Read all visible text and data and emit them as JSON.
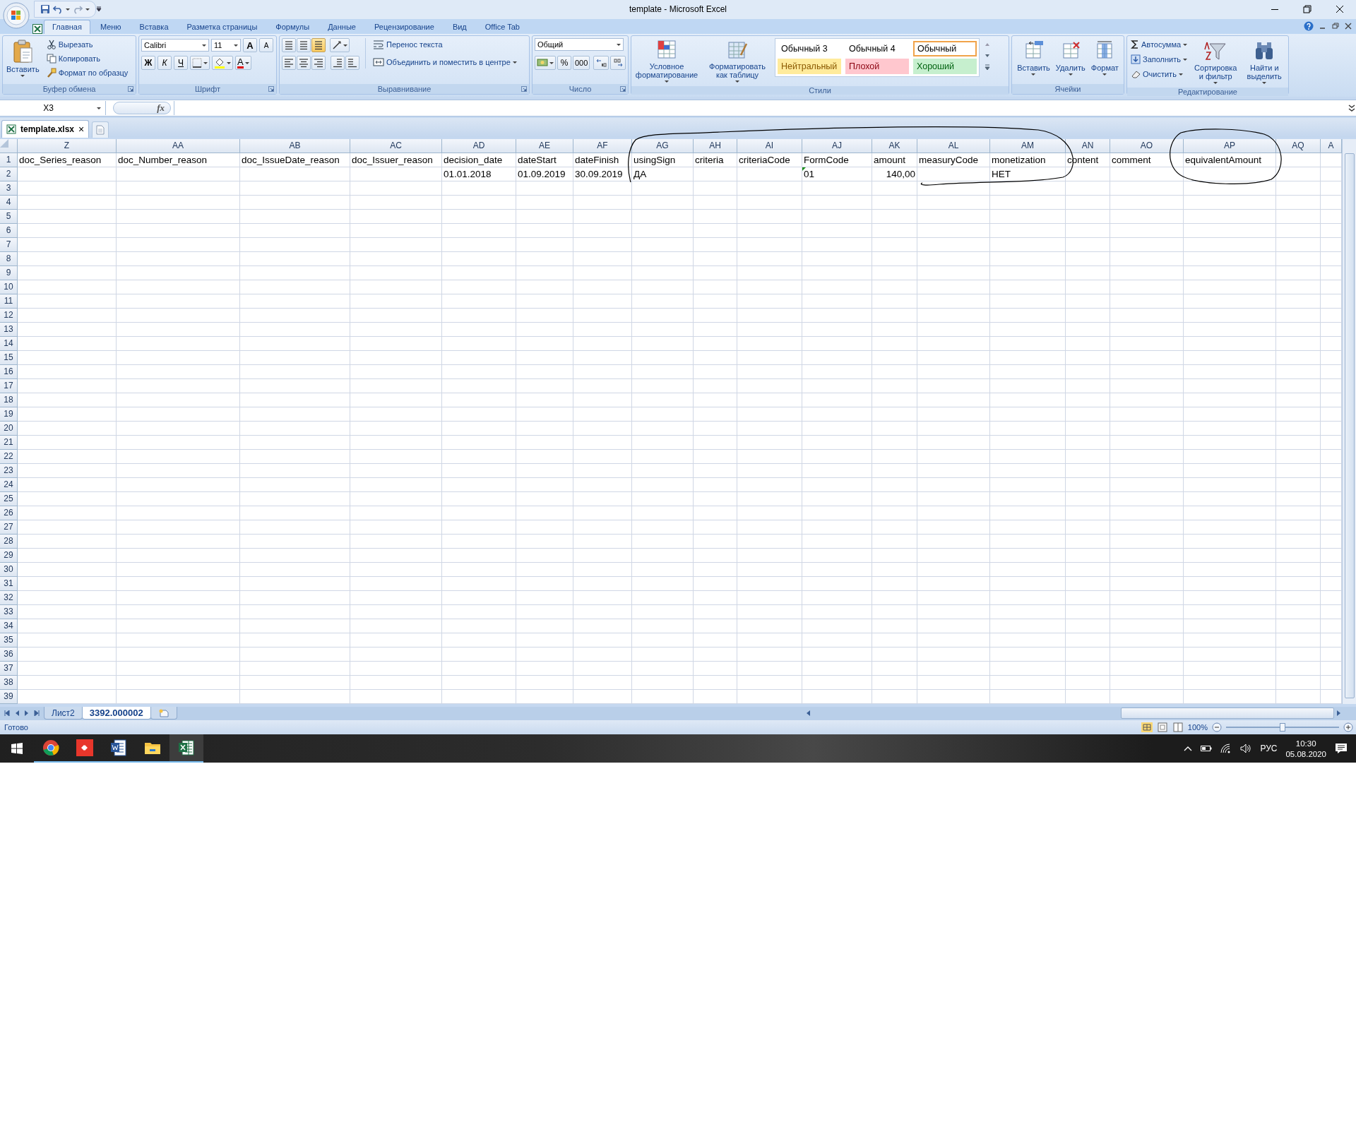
{
  "window": {
    "title": "template - Microsoft Excel"
  },
  "ribbon_tabs": [
    {
      "label": "Главная",
      "selected": true
    },
    {
      "label": "Меню",
      "selected": false
    },
    {
      "label": "Вставка",
      "selected": false
    },
    {
      "label": "Разметка страницы",
      "selected": false
    },
    {
      "label": "Формулы",
      "selected": false
    },
    {
      "label": "Данные",
      "selected": false
    },
    {
      "label": "Рецензирование",
      "selected": false
    },
    {
      "label": "Вид",
      "selected": false
    },
    {
      "label": "Office Tab",
      "selected": false
    }
  ],
  "clipboard": {
    "paste": "Вставить",
    "cut": "Вырезать",
    "copy": "Копировать",
    "format_painter": "Формат по образцу",
    "group_label": "Буфер обмена"
  },
  "font": {
    "name": "Calibri",
    "size": "11",
    "grow": "A",
    "shrink": "A",
    "bold": "Ж",
    "italic": "К",
    "underline": "Ч",
    "font_color_button": "A",
    "group_label": "Шрифт"
  },
  "alignment": {
    "wrap": "Перенос текста",
    "merge": "Объединить и поместить в центре",
    "group_label": "Выравнивание"
  },
  "number": {
    "format": "Общий",
    "percent": "%",
    "thousands": "000",
    "group_label": "Число"
  },
  "styles": {
    "conditional": "Условное форматирование",
    "as_table": "Форматировать как таблицу",
    "group_label": "Стили",
    "cell_styles": [
      {
        "label": "Обычный 3",
        "color": "#ffffff",
        "selected": false
      },
      {
        "label": "Обычный 4",
        "color": "#ffffff",
        "selected": false
      },
      {
        "label": "Обычный",
        "color": "#ffffff",
        "selected": true
      },
      {
        "label": "Нейтральный",
        "color": "#ffeb9c",
        "selected": false
      },
      {
        "label": "Плохой",
        "color": "#ffc7ce",
        "selected": false
      },
      {
        "label": "Хороший",
        "color": "#c6efce",
        "selected": false
      }
    ]
  },
  "cells": {
    "insert": "Вставить",
    "delete": "Удалить",
    "format": "Формат",
    "group_label": "Ячейки"
  },
  "editing": {
    "autosum": "Автосумма",
    "fill": "Заполнить",
    "clear": "Очистить",
    "sort": "Сортировка и фильтр",
    "find": "Найти и выделить",
    "group_label": "Редактирование"
  },
  "formula_bar": {
    "name_box": "X3",
    "fx": "fx"
  },
  "workbook_tabs": [
    {
      "label": "template.xlsx",
      "selected": true,
      "close": "×"
    }
  ],
  "sheet": {
    "columns": [
      "Z",
      "AA",
      "AB",
      "AC",
      "AD",
      "AE",
      "AF",
      "AG",
      "AH",
      "AI",
      "AJ",
      "AK",
      "AL",
      "AM",
      "AN",
      "AO",
      "AP",
      "AQ",
      "A"
    ],
    "rows": [
      {
        "number": "1",
        "cells": [
          {
            "value": "doc_Series_reason",
            "kind": "text",
            "error_mark": false
          },
          {
            "value": "doc_Number_reason",
            "kind": "text",
            "error_mark": false
          },
          {
            "value": "doc_IssueDate_reason",
            "kind": "text",
            "error_mark": false
          },
          {
            "value": "doc_Issuer_reason",
            "kind": "text",
            "error_mark": false
          },
          {
            "value": "decision_date",
            "kind": "text",
            "error_mark": false
          },
          {
            "value": "dateStart",
            "kind": "text",
            "error_mark": false
          },
          {
            "value": "dateFinish",
            "kind": "text",
            "error_mark": false
          },
          {
            "value": "usingSign",
            "kind": "text",
            "error_mark": false
          },
          {
            "value": "criteria",
            "kind": "text",
            "error_mark": false
          },
          {
            "value": "criteriaCode",
            "kind": "text",
            "error_mark": false
          },
          {
            "value": "FormCode",
            "kind": "text",
            "error_mark": false
          },
          {
            "value": "amount",
            "kind": "text",
            "error_mark": false
          },
          {
            "value": "measuryCode",
            "kind": "text",
            "error_mark": false
          },
          {
            "value": "monetization",
            "kind": "text",
            "error_mark": false
          },
          {
            "value": "content",
            "kind": "text",
            "error_mark": false
          },
          {
            "value": "comment",
            "kind": "text",
            "error_mark": false
          },
          {
            "value": "equivalentAmount",
            "kind": "text",
            "error_mark": false
          },
          null,
          null
        ]
      },
      {
        "number": "2",
        "cells": [
          null,
          null,
          null,
          null,
          {
            "value": "01.01.2018",
            "kind": "text",
            "error_mark": false
          },
          {
            "value": "01.09.2019",
            "kind": "text",
            "error_mark": false
          },
          {
            "value": "30.09.2019",
            "kind": "text",
            "error_mark": false
          },
          {
            "value": "ДА",
            "kind": "text",
            "error_mark": false
          },
          null,
          null,
          {
            "value": "01",
            "kind": "text",
            "error_mark": true
          },
          {
            "value": "140,00",
            "kind": "number",
            "error_mark": false
          },
          null,
          {
            "value": "НЕТ",
            "kind": "text",
            "error_mark": false
          },
          null,
          null,
          null,
          null,
          null
        ]
      },
      {
        "number": "3"
      },
      {
        "number": "4"
      },
      {
        "number": "5"
      },
      {
        "number": "6"
      },
      {
        "number": "7"
      },
      {
        "number": "8"
      },
      {
        "number": "9"
      },
      {
        "number": "10"
      },
      {
        "number": "11"
      },
      {
        "number": "12"
      },
      {
        "number": "13"
      },
      {
        "number": "14"
      },
      {
        "number": "15"
      },
      {
        "number": "16"
      },
      {
        "number": "17"
      },
      {
        "number": "18"
      },
      {
        "number": "19"
      },
      {
        "number": "20"
      },
      {
        "number": "21"
      },
      {
        "number": "22"
      },
      {
        "number": "23"
      },
      {
        "number": "24"
      },
      {
        "number": "25"
      },
      {
        "number": "26"
      },
      {
        "number": "27"
      },
      {
        "number": "28"
      },
      {
        "number": "29"
      },
      {
        "number": "30"
      },
      {
        "number": "31"
      },
      {
        "number": "32"
      },
      {
        "number": "33"
      },
      {
        "number": "34"
      },
      {
        "number": "35"
      },
      {
        "number": "36"
      },
      {
        "number": "37"
      },
      {
        "number": "38"
      },
      {
        "number": "39"
      }
    ]
  },
  "sheet_tabs": [
    {
      "label": "Лист2",
      "selected": false
    },
    {
      "label": "3392.000002",
      "selected": true
    }
  ],
  "status_bar": {
    "status": "Готово",
    "zoom": "100%",
    "zoom_slider": {
      "level": 0.5
    }
  },
  "taskbar": {
    "apps": [
      {
        "kind": "chrome",
        "selected": false
      },
      {
        "kind": "anydesk",
        "selected": false
      },
      {
        "kind": "word",
        "selected": false
      },
      {
        "kind": "explorer",
        "selected": false
      },
      {
        "kind": "excel",
        "selected": true
      }
    ],
    "language": "РУС",
    "time": "10:30",
    "date": "05.08.2020"
  }
}
